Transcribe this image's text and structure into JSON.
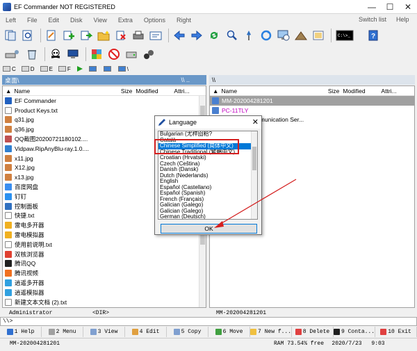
{
  "window": {
    "title": "EF Commander NOT REGISTERED",
    "controls": [
      "—",
      "☐",
      "✕"
    ]
  },
  "menu": {
    "items": [
      "Left",
      "File",
      "Edit",
      "Disk",
      "View",
      "Extra",
      "Options",
      "Right"
    ],
    "switch_list": "Switch list",
    "help": "Help"
  },
  "drives": {
    "left": [
      "C",
      "D",
      "E",
      "F"
    ],
    "right_extra": "\\"
  },
  "left_pane": {
    "path": "桌面\\",
    "nav_symbols": "\\\\ ..",
    "columns": [
      "Name",
      "Size",
      "Modified",
      "Attri..."
    ],
    "files": [
      {
        "name": "EF Commander",
        "color": "#2060c0"
      },
      {
        "name": "Product Keys.txt",
        "color": "#ffffff"
      },
      {
        "name": "q31.jpg",
        "color": "#d08040"
      },
      {
        "name": "q36.jpg",
        "color": "#d08040"
      },
      {
        "name": "QQ截图20200721180102....",
        "color": "#c05050"
      },
      {
        "name": "Vidpaw.RipAnyBlu-ray.1.0....",
        "color": "#3080d0"
      },
      {
        "name": "x11.jpg",
        "color": "#d08040"
      },
      {
        "name": "X12.jpg",
        "color": "#d08040"
      },
      {
        "name": "x13.jpg",
        "color": "#d08040"
      },
      {
        "name": "百度网盘",
        "color": "#3a8ef0"
      },
      {
        "name": "钉钉",
        "color": "#2a90f0"
      },
      {
        "name": "控制面板",
        "color": "#3070c0"
      },
      {
        "name": "快捷.txt",
        "color": "#ffffff"
      },
      {
        "name": "雷电多开器",
        "color": "#f0b020"
      },
      {
        "name": "雷电模拟器",
        "color": "#f0b020"
      },
      {
        "name": "使用前说明.txt",
        "color": "#ffffff"
      },
      {
        "name": "双核浏览器",
        "color": "#e04030"
      },
      {
        "name": "腾讯QQ",
        "color": "#202020"
      },
      {
        "name": "腾讯视频",
        "color": "#f07020"
      },
      {
        "name": "逍遥多开器",
        "color": "#30a0e0"
      },
      {
        "name": "逍遥模拟器",
        "color": "#30a0e0"
      },
      {
        "name": "新建文本文档 (2).txt",
        "color": "#ffffff"
      }
    ],
    "status_left": "Administrator",
    "status_right": "<DIR>"
  },
  "right_pane": {
    "path": "\\\\",
    "columns": [
      "Name",
      "Size",
      "Modified",
      "Attri..."
    ],
    "items": [
      {
        "name": "MM-202004281201",
        "selected": true
      },
      {
        "name": "PC-11TLY",
        "selected": false,
        "color": "#c000c0"
      },
      {
        "name": "Microsoft Communication Ser...",
        "selected": false,
        "partial": "cation Ser..."
      }
    ],
    "status_left": "MM-202004281201"
  },
  "dialog": {
    "title": "Language",
    "close": "✕",
    "languages": [
      "Bulgarian (尤梓囵粭?",
      "Català",
      "Chinese Simplified (简体中文)",
      "Chinese Traditional (繁體中文)",
      "Croatian (Hrvatski)",
      "Czech (Čeština)",
      "Danish (Dansk)",
      "Dutch (Nederlands)",
      "English",
      "Español (Castellano)",
      "Español (Spanish)",
      "French (Français)",
      "Galician (Galego)",
      "Galician (Galego)",
      "German (Deutsch)"
    ],
    "selected_index": 2,
    "ok_label": "OK"
  },
  "command_line": "\\\\>",
  "fkeys": [
    {
      "num": "1",
      "label": "Help"
    },
    {
      "num": "2",
      "label": "Menu"
    },
    {
      "num": "3",
      "label": "View"
    },
    {
      "num": "4",
      "label": "Edit"
    },
    {
      "num": "5",
      "label": "Copy"
    },
    {
      "num": "6",
      "label": "Move"
    },
    {
      "num": "7",
      "label": "New f..."
    },
    {
      "num": "8",
      "label": "Delete"
    },
    {
      "num": "9",
      "label": "Conta..."
    },
    {
      "num": "10",
      "label": "Exit"
    }
  ],
  "bottom_status": {
    "computer": "MM-202004281201",
    "ram": "RAM 73.54% free",
    "date": "2020/7/23",
    "time": "9:03"
  },
  "colors": {
    "active_path": "#6a98c8",
    "selection": "#0078d7",
    "right_selected": "#a0a0a0",
    "highlight_box": "#d42020",
    "arrow": "#d42020"
  }
}
